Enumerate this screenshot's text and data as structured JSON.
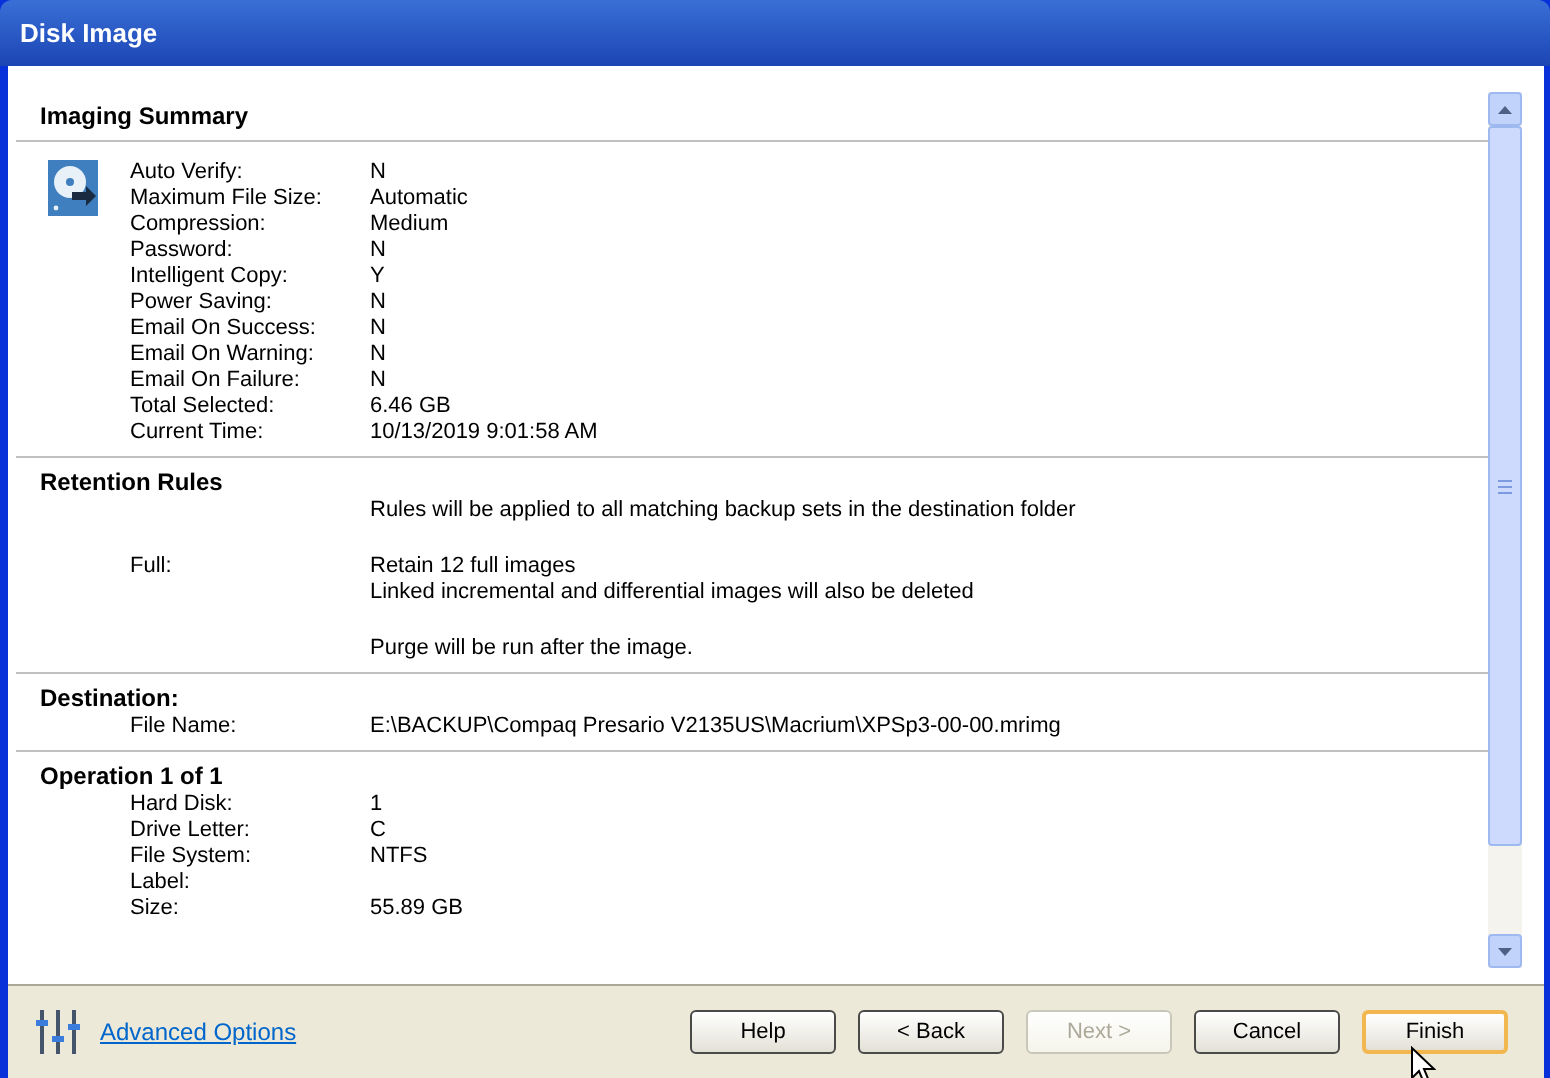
{
  "window": {
    "title": "Disk Image"
  },
  "sections": [
    {
      "title": "Imaging Summary",
      "icon": true,
      "rows": [
        {
          "kind": "line",
          "label": "Auto Verify:",
          "value": "N"
        },
        {
          "kind": "line",
          "label": "Maximum File Size:",
          "value": "Automatic"
        },
        {
          "kind": "line",
          "label": "Compression:",
          "value": "Medium"
        },
        {
          "kind": "line",
          "label": "Password:",
          "value": "N"
        },
        {
          "kind": "line",
          "label": "Intelligent Copy:",
          "value": "Y"
        },
        {
          "kind": "line",
          "label": "Power Saving:",
          "value": "N"
        },
        {
          "kind": "line",
          "label": "Email On Success:",
          "value": "N"
        },
        {
          "kind": "line",
          "label": "Email On Warning:",
          "value": "N"
        },
        {
          "kind": "line",
          "label": "Email On Failure:",
          "value": "N"
        },
        {
          "kind": "line",
          "label": "Total Selected:",
          "value": "6.46 GB"
        },
        {
          "kind": "line",
          "label": "Current Time:",
          "value": "10/13/2019 9:01:58 AM"
        }
      ]
    },
    {
      "title": "Retention Rules",
      "icon": false,
      "rows": [
        {
          "kind": "line",
          "value": "Rules will be applied to all matching backup sets in the destination folder"
        },
        {
          "kind": "paragraph",
          "label": "Full:",
          "value": "Retain 12 full images"
        },
        {
          "kind": "line",
          "value": "Linked incremental and differential images will also be deleted"
        },
        {
          "kind": "paragraph",
          "value": "Purge will be run after the image."
        }
      ]
    },
    {
      "title": "Destination:",
      "icon": false,
      "rows": [
        {
          "kind": "line",
          "label": "File Name:",
          "value": "E:\\BACKUP\\Compaq Presario V2135US\\Macrium\\XPSp3-00-00.mrimg"
        }
      ]
    },
    {
      "title": "Operation 1 of 1",
      "icon": false,
      "rows": [
        {
          "kind": "line",
          "label": "Hard Disk:",
          "value": "1"
        },
        {
          "kind": "line",
          "label": "Drive Letter:",
          "value": "C"
        },
        {
          "kind": "line",
          "label": "File System:",
          "value": "NTFS"
        },
        {
          "kind": "line",
          "label": "Label:"
        },
        {
          "kind": "line",
          "label": "Size:",
          "value": "55.89 GB"
        }
      ]
    }
  ],
  "advanced_link": "Advanced Options",
  "buttons": [
    {
      "label": "Help",
      "disabled": false,
      "default": false
    },
    {
      "label": "< Back",
      "disabled": false,
      "default": false
    },
    {
      "label": "Next >",
      "disabled": true,
      "default": false
    },
    {
      "label": "Cancel",
      "disabled": false,
      "default": false
    },
    {
      "label": "Finish",
      "disabled": false,
      "default": true
    }
  ]
}
